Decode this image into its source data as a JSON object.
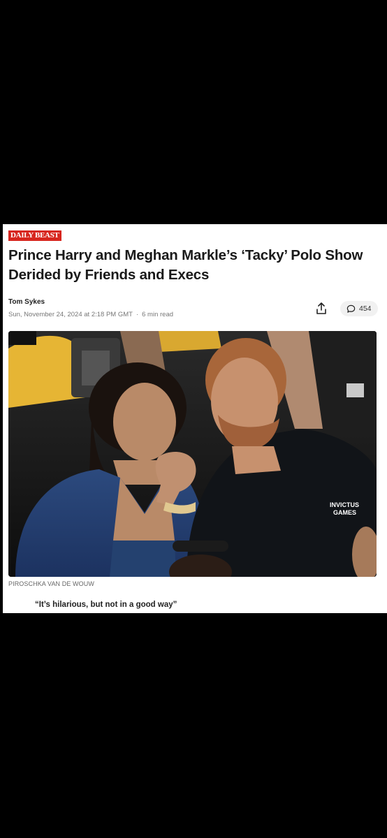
{
  "publication": {
    "logo_text": "Daily Beast"
  },
  "article": {
    "headline": "Prince Harry and Meghan Markle’s ‘Tacky’ Polo Show Derided by Friends and Execs",
    "author": "Tom Sykes",
    "date": "Sun, November 24, 2024 at 2:18 PM GMT",
    "separator": "·",
    "read_time": "6 min read",
    "comment_count": "454",
    "photo_credit": "PIROSCHKA VAN DE WOUW",
    "pull_quote": "“It’s hilarious, but not in a good way”"
  },
  "photo": {
    "shirt_text_line1": "INVICTUS",
    "shirt_text_line2": "GAMES"
  },
  "icons": {
    "share": "share-icon",
    "comment": "comment-icon"
  },
  "colors": {
    "background": "#000000",
    "logo_red": "#d7261e",
    "card": "#ffffff"
  }
}
